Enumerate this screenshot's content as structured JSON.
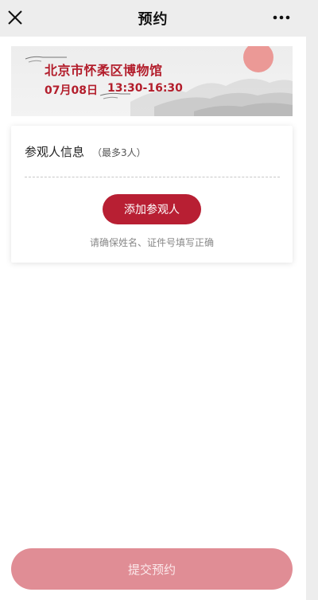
{
  "nav": {
    "title": "预约",
    "close_icon": "close-icon",
    "more_icon": "more-icon"
  },
  "banner": {
    "museum_name": "北京市怀柔区博物馆",
    "date": "07月08日",
    "time": "13:30-16:30"
  },
  "visitor_card": {
    "title": "参观人信息",
    "limit_hint": "（最多3人）",
    "add_button_label": "添加参观人",
    "tip": "请确保姓名、证件号填写正确"
  },
  "footer": {
    "submit_label": "提交预约"
  },
  "colors": {
    "accent": "#b81f33",
    "submit_disabled": "#e08d95",
    "nav_bg": "#ededed"
  }
}
